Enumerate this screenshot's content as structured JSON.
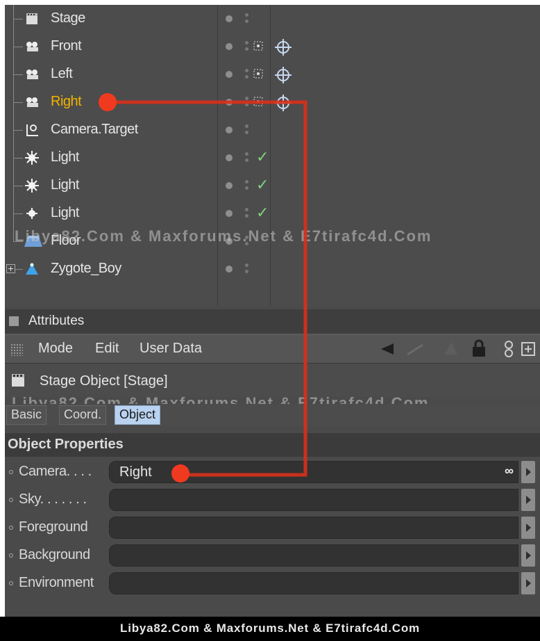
{
  "object_manager": {
    "objects": [
      {
        "name": "Stage",
        "icon": "stage-icon",
        "active": false,
        "tags": []
      },
      {
        "name": "Front",
        "icon": "camera-icon",
        "active": false,
        "tags": [
          "target-tag",
          "crosshair-tag"
        ]
      },
      {
        "name": "Left",
        "icon": "camera-icon",
        "active": false,
        "tags": [
          "target-tag",
          "crosshair-tag"
        ]
      },
      {
        "name": "Right",
        "icon": "camera-icon",
        "active": true,
        "tags": [
          "target-tag",
          "crosshair-tag"
        ]
      },
      {
        "name": "Camera.Target",
        "icon": "null-target-icon",
        "active": false,
        "tags": []
      },
      {
        "name": "Light",
        "icon": "light-icon",
        "active": false,
        "tags": [
          "check"
        ]
      },
      {
        "name": "Light",
        "icon": "light-icon",
        "active": false,
        "tags": [
          "check"
        ]
      },
      {
        "name": "Light",
        "icon": "light-icon",
        "active": false,
        "tags": [
          "check"
        ]
      },
      {
        "name": "Floor",
        "icon": "floor-icon",
        "active": false,
        "tags": []
      },
      {
        "name": "Zygote_Boy",
        "icon": "figure-icon",
        "active": false,
        "tags": [],
        "expandable": true
      }
    ]
  },
  "attributes": {
    "title": "Attributes",
    "menu": [
      "Mode",
      "Edit",
      "User Data"
    ],
    "object_title": "Stage Object [Stage]",
    "tabs": [
      "Basic",
      "Coord.",
      "Object"
    ],
    "selected_tab": "Object",
    "section_title": "Object Properties",
    "properties": [
      {
        "label": "Camera. . . .",
        "value": "Right",
        "link_icon": "∞"
      },
      {
        "label": "Sky. . . . . . .",
        "value": ""
      },
      {
        "label": "Foreground",
        "value": ""
      },
      {
        "label": "Background",
        "value": ""
      },
      {
        "label": "Environment",
        "value": ""
      }
    ]
  },
  "watermark": "Libya82.Com & Maxforums.Net & E7tirafc4d.Com",
  "footer": "Libya82.Com & Maxforums.Net & E7tirafc4d.Com",
  "colors": {
    "active_name": "#f0b400",
    "annotation": "#e8341c",
    "tab_selected": "#b9d2ef",
    "check": "#7fd07f"
  }
}
